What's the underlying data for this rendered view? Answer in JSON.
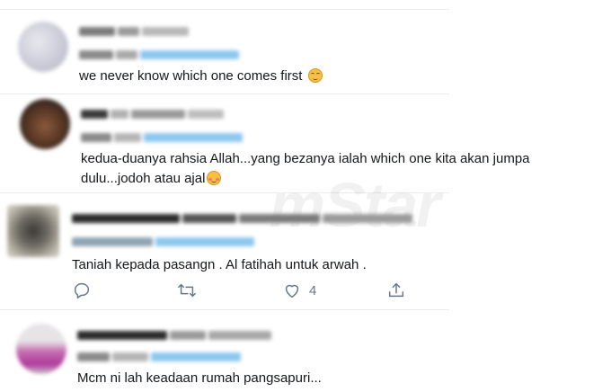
{
  "watermark": "mStar",
  "tweets": [
    {
      "text": "we never know which one comes first",
      "emoji": "relieved-face"
    },
    {
      "text_line1": "kedua-duanya rahsia Allah...yang bezanya ialah which one kita akan jumpa",
      "text_line2": "dulu...jodoh atau ajal",
      "emoji": "smiling-face-with-smiling-eyes"
    },
    {
      "text": "Taniah kepada pasangn . Al fatihah untuk arwah .",
      "actions": {
        "like_count": "4"
      }
    },
    {
      "text": "Mcm ni lah keadaan rumah pangsapuri..."
    }
  ],
  "colors": {
    "text": "#14171a",
    "muted": "#657786",
    "link": "#1da1f2",
    "divider": "#e6ecf0"
  }
}
